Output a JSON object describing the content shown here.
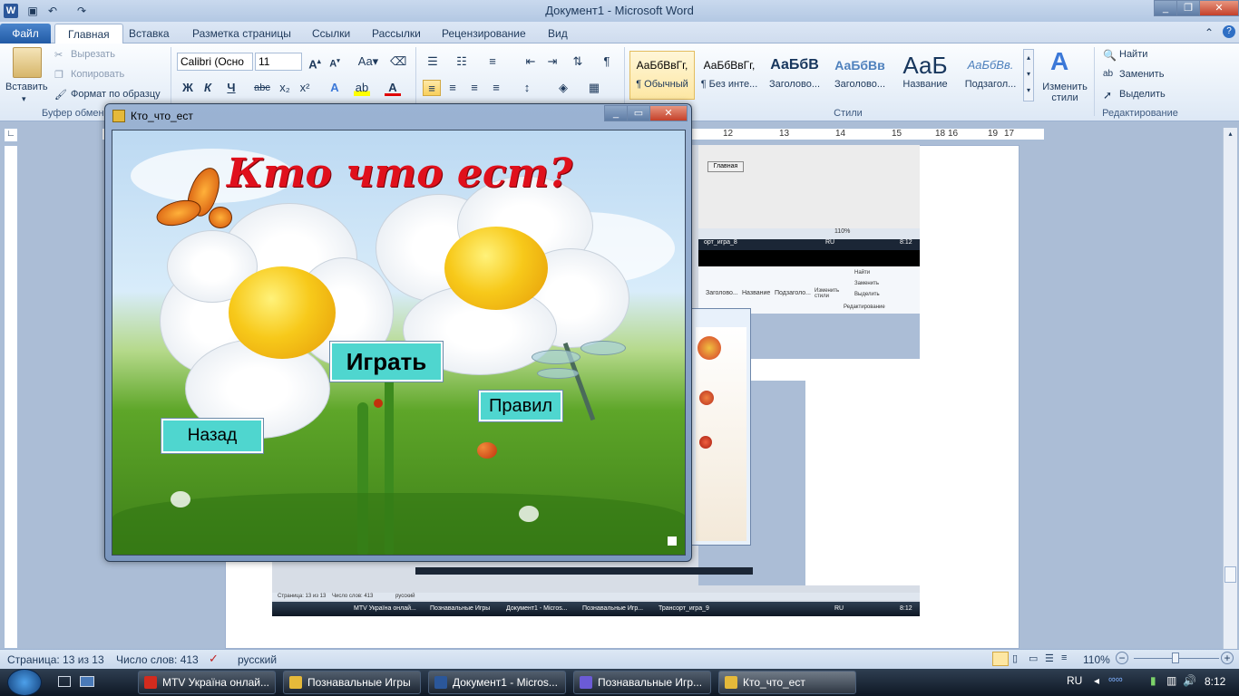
{
  "word": {
    "title": "Документ1 - Microsoft Word",
    "app_icon": "W",
    "quick_access": {
      "save_icon": "save-icon",
      "undo_icon": "undo-icon",
      "redo_icon": "redo-icon"
    },
    "tabs": [
      "Файл",
      "Главная",
      "Вставка",
      "Разметка страницы",
      "Ссылки",
      "Рассылки",
      "Рецензирование",
      "Вид"
    ],
    "clipboard": {
      "paste": "Вставить",
      "cut": "Вырезать",
      "copy": "Копировать",
      "format_painter": "Формат по образцу",
      "group": "Буфер обмен"
    },
    "font": {
      "name": "Calibri (Осно",
      "size": "11",
      "bold": "Ж",
      "italic": "К",
      "underline": "Ч"
    },
    "styles": {
      "group": "Стили",
      "items": [
        {
          "sample": "АаБбВвГг,",
          "name": "¶ Обычный"
        },
        {
          "sample": "АаБбВвГг,",
          "name": "¶ Без инте..."
        },
        {
          "sample": "АаБбВ",
          "name": "Заголово..."
        },
        {
          "sample": "АаБбВв",
          "name": "Заголово..."
        },
        {
          "sample": "АаБ",
          "name": "Название"
        },
        {
          "sample": "АаБбВв.",
          "name": "Подзагол..."
        }
      ],
      "change": "Изменить стили"
    },
    "editing": {
      "group": "Редактирование",
      "find": "Найти",
      "replace": "Заменить",
      "select": "Выделить"
    },
    "status": {
      "page": "Страница: 13 из 13",
      "words": "Число слов: 413",
      "lang": "русский",
      "zoom": "110%"
    },
    "ruler_numbers": [
      "12",
      "13",
      "14",
      "15",
      "16",
      "17",
      "18",
      "19"
    ]
  },
  "embedded": {
    "inner_button": "Главная",
    "status_page": "Страница: 13 из 13",
    "status_words": "Число слов: 413",
    "status_lang": "русский",
    "zoom": "110%",
    "time": "8:12",
    "lang": "RU",
    "taskbar": [
      "MTV Україна онлай...",
      "Познавальные Игры",
      "Документ1 - Micros...",
      "Познавальные Игр...",
      "Трансорт_игра_9"
    ],
    "mini_styles": [
      "Заголово...",
      "Название",
      "Подзаголо..."
    ],
    "mini_edit": [
      "Найти",
      "Заменить",
      "Выделить"
    ],
    "mini_change": "Изменить стили",
    "mini_group": "Редактирование",
    "tab_label": "орт_игра_8"
  },
  "game": {
    "window_title": "Кто_что_ест",
    "heading": "Кто что ест?",
    "play": "Играть",
    "rules": "Правил",
    "back": "Назад"
  },
  "taskbar": {
    "items": [
      {
        "label": "MTV Україна онлай...",
        "color": "#d32b1e"
      },
      {
        "label": "Познавальные Игры",
        "color": "#e5b93a"
      },
      {
        "label": "Документ1 - Micros...",
        "color": "#2b579a"
      },
      {
        "label": "Познавальные Игр...",
        "color": "#6b5bd6"
      },
      {
        "label": "Кто_что_ест",
        "color": "#e5b93a"
      }
    ],
    "lang": "RU",
    "time": "8:12"
  }
}
